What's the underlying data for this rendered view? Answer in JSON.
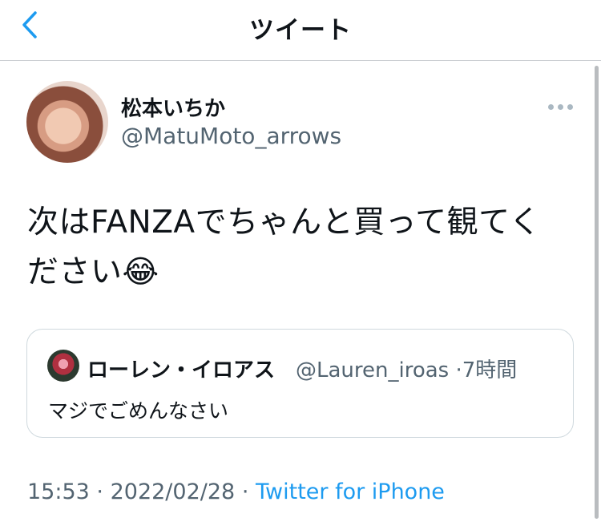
{
  "nav": {
    "title": "ツイート",
    "back_icon": "chevron-left-icon"
  },
  "tweet": {
    "display_name": "松本いちか",
    "handle": "@MatuMoto_arrows",
    "text_line1": "次はFANZAでちゃんと買って観てく",
    "text_line2": "ださい😂",
    "more_icon": "ellipsis-icon"
  },
  "quote": {
    "display_name": "ローレン・イロアス",
    "handle": "@Lauren_iroas",
    "separator": "·",
    "time": "7時間",
    "text": "マジでごめんなさい"
  },
  "footer": {
    "time": "15:53",
    "separator": "·",
    "date": "2022/02/28",
    "source": "Twitter for iPhone"
  },
  "colors": {
    "accent": "#1d9bf0",
    "secondary_text": "#536471",
    "border": "#cfd9de"
  }
}
